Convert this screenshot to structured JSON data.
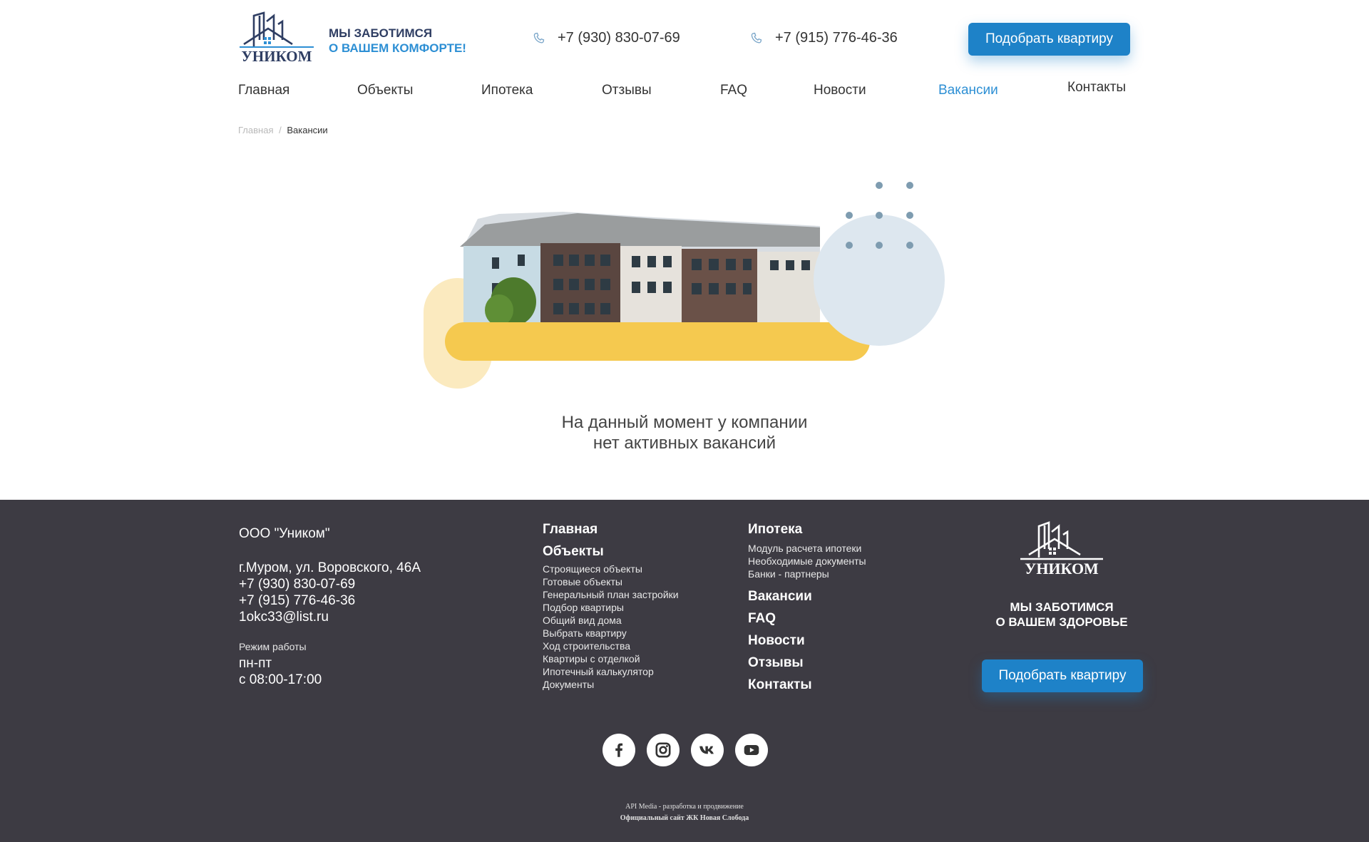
{
  "header": {
    "logo_text": "УНИКОМ",
    "tagline_line1": "МЫ ЗАБОТИМСЯ",
    "tagline_line2": "О ВАШЕМ КОМФОРТЕ!",
    "phone1": "+7 (930) 830-07-69",
    "phone2": "+7 (915) 776-46-36",
    "cta_label": "Подобрать квартиру",
    "phone_icon": "phone-icon"
  },
  "nav": {
    "items": [
      {
        "label": "Главная"
      },
      {
        "label": "Объекты"
      },
      {
        "label": "Ипотека"
      },
      {
        "label": "Отзывы"
      },
      {
        "label": "FAQ"
      },
      {
        "label": "Новости"
      },
      {
        "label": "Вакансии"
      },
      {
        "label": "Контакты"
      }
    ],
    "active": "Вакансии"
  },
  "breadcrumb": {
    "home": "Главная",
    "separator": "/",
    "current": "Вакансии"
  },
  "main": {
    "message_line1": "На данный момент у компании",
    "message_line2": "нет активных вакансий"
  },
  "footer": {
    "company": "ООО \"Уником\"",
    "address": "г.Муром, ул. Воровского, 46А",
    "phone1": "+7 (930) 830-07-69",
    "phone2": "+7 (915) 776-46-36",
    "email": "1okc33@list.ru",
    "hours_label": "Режим работы",
    "hours_days": "пн-пт",
    "hours_time": "с 08:00-17:00",
    "col2": {
      "home": "Главная",
      "objects": "Объекты",
      "objects_links": [
        "Строящиеся объекты",
        "Готовые объекты",
        "Генеральный план застройки",
        "Подбор квартиры",
        "Общий вид дома",
        "Выбрать квартиру",
        "Ход строительства",
        "Квартиры с отделкой",
        "Ипотечный калькулятор",
        "Документы"
      ]
    },
    "col3": {
      "mortgage": "Ипотека",
      "mortgage_links": [
        "Модуль расчета ипотеки",
        "Необходимые документы",
        "Банки - партнеры"
      ],
      "links": [
        "Вакансии",
        "FAQ",
        "Новости",
        "Отзывы",
        "Контакты"
      ]
    },
    "logo_text": "УНИКОМ",
    "tagline_line1": "МЫ ЗАБОТИМСЯ",
    "tagline_line2": "О ВАШЕМ ЗДОРОВЬЕ",
    "cta_label": "Подобрать квартиру",
    "socials": [
      "facebook-icon",
      "instagram-icon",
      "vk-icon",
      "youtube-icon"
    ],
    "credit_line1": "API Media - разработка и продвижение",
    "credit_line2": "Официальный сайт ЖК Новая Слобода"
  },
  "colors": {
    "accent": "#1e82c8",
    "accent_text": "#2d8fd4",
    "dark_blue": "#2f3e63",
    "footer_bg": "#3d3b43",
    "yellow": "#f5c94f",
    "light_blue": "#dde7ef"
  }
}
